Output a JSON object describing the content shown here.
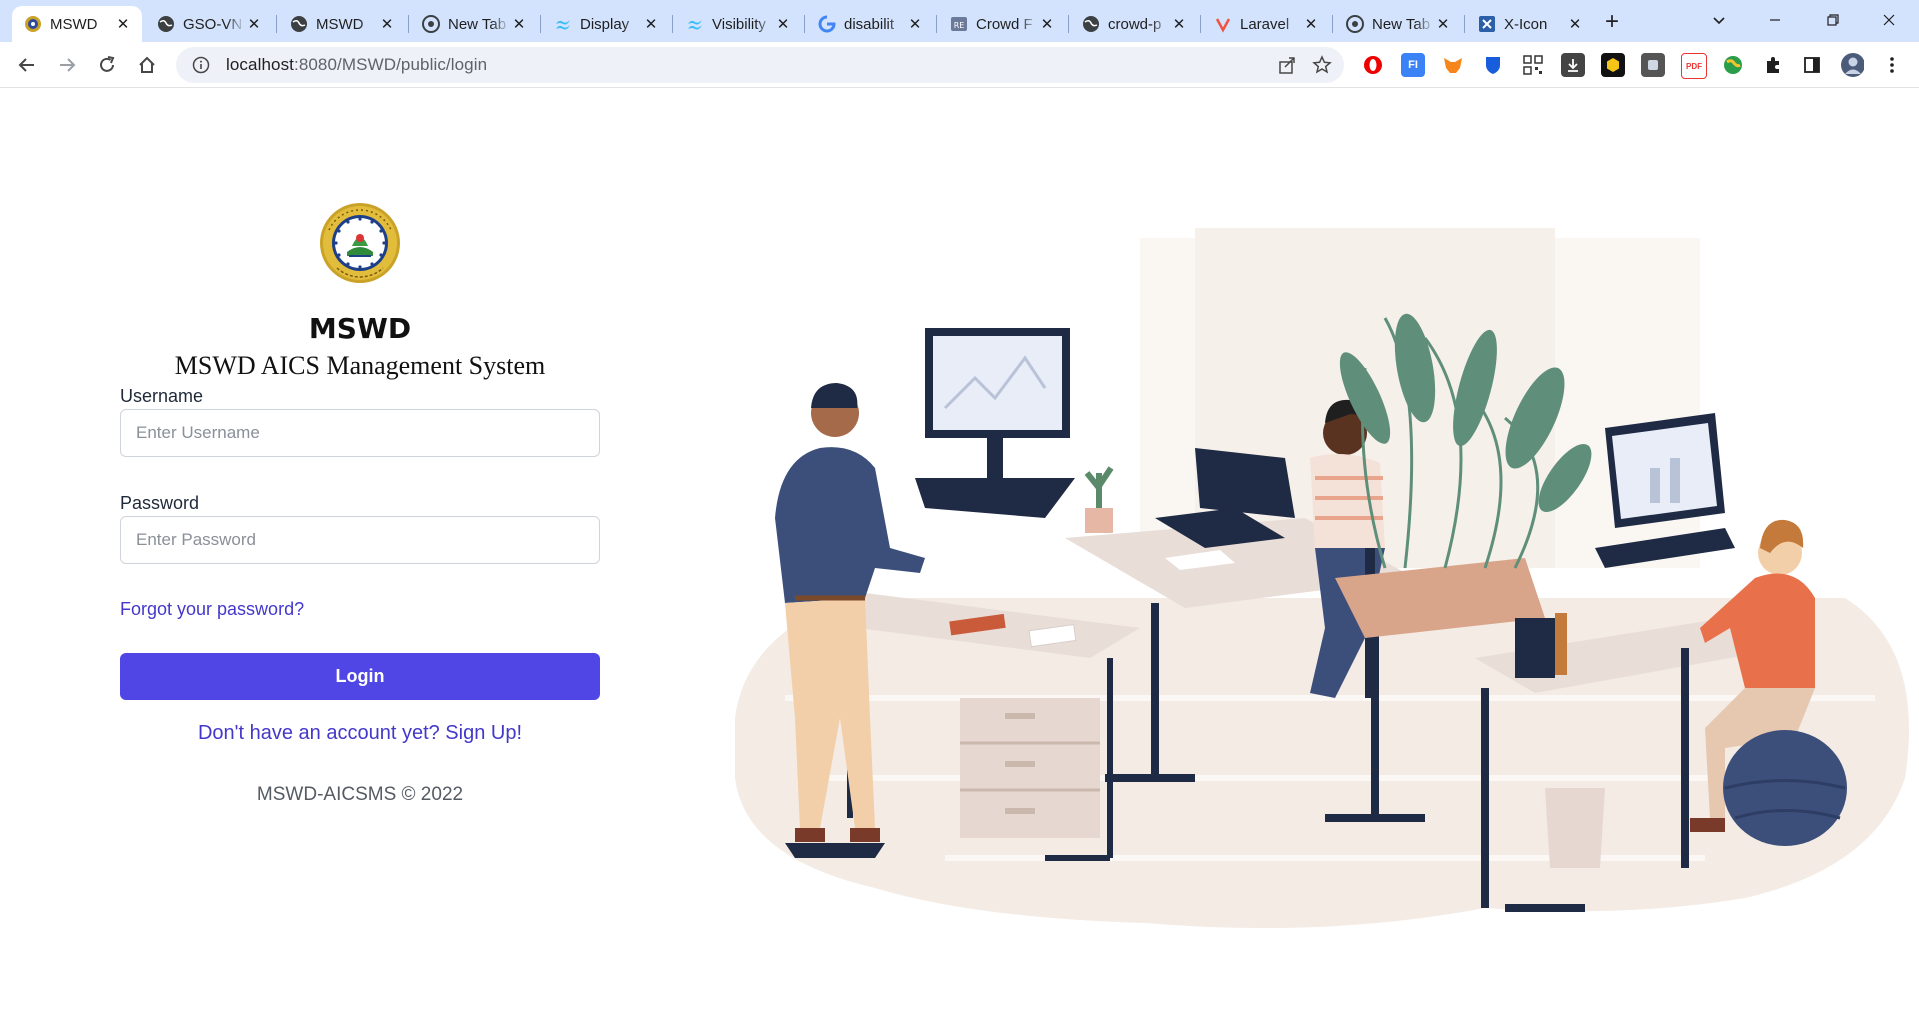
{
  "browser": {
    "tabs": [
      {
        "title": "MSWD",
        "favicon": "seal-favicon",
        "active": true
      },
      {
        "title": "GSO-VN",
        "favicon": "globe-favicon"
      },
      {
        "title": "MSWD",
        "favicon": "globe-favicon"
      },
      {
        "title": "New Tab",
        "favicon": "chrome-favicon"
      },
      {
        "title": "Display",
        "favicon": "tailwind-favicon"
      },
      {
        "title": "Visibility",
        "favicon": "tailwind-favicon"
      },
      {
        "title": "disabilit",
        "favicon": "google-favicon"
      },
      {
        "title": "Crowd F",
        "favicon": "repo-favicon"
      },
      {
        "title": "crowd-p",
        "favicon": "globe-favicon"
      },
      {
        "title": "Laravel",
        "favicon": "laravel-favicon"
      },
      {
        "title": "New Tab",
        "favicon": "chrome-favicon"
      },
      {
        "title": "X-Icon",
        "favicon": "x-icon-favicon"
      }
    ],
    "url_host": "localhost",
    "url_path": ":8080/MSWD/public/login"
  },
  "login": {
    "logo_alt": "Municipality of Kalibo Aklan seal",
    "title": "MSWD",
    "subtitle": "MSWD AICS Management System",
    "username_label": "Username",
    "username_placeholder": "Enter Username",
    "password_label": "Password",
    "password_placeholder": "Enter Password",
    "forgot_link": "Forgot your password?",
    "login_button": "Login",
    "signup_link": "Don't have an account yet? Sign Up!",
    "footer": "MSWD-AICSMS © 2022"
  },
  "colors": {
    "primary": "#4f46e5",
    "link": "#4338ca",
    "tabstrip": "#d3e3fd"
  }
}
